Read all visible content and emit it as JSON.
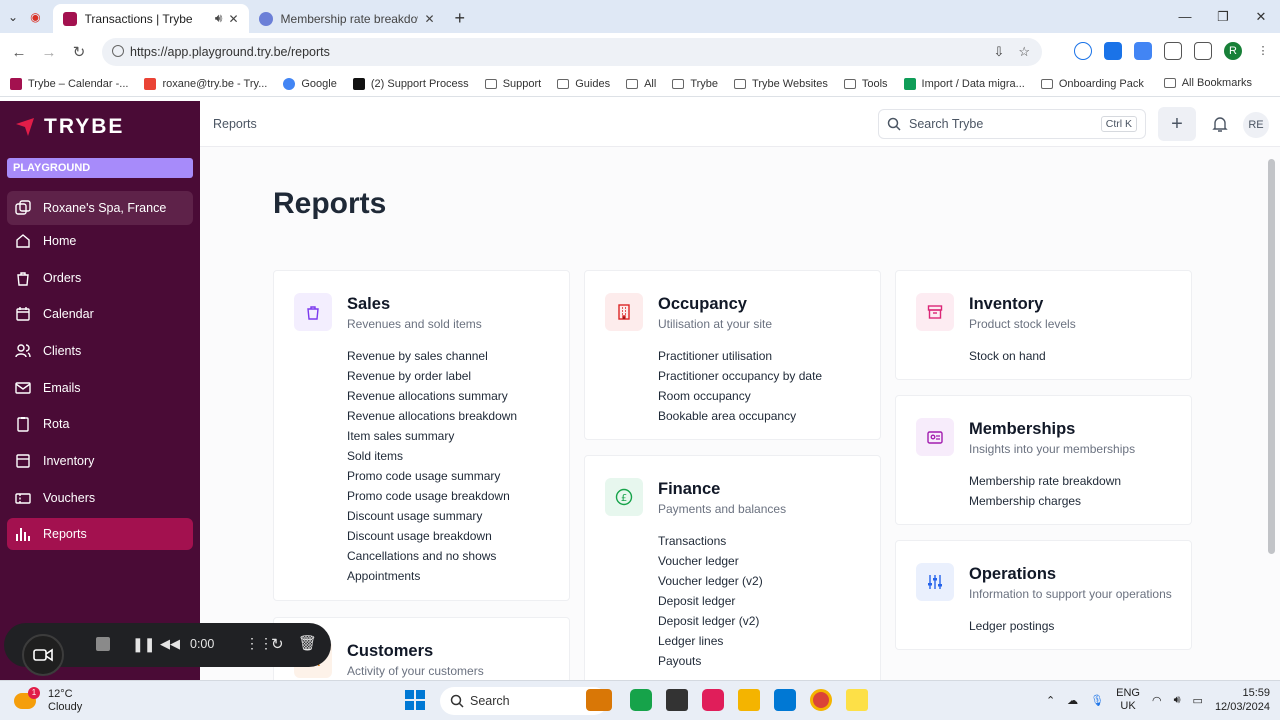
{
  "browser": {
    "tabs": [
      {
        "title": "Transactions | Trybe",
        "active": true
      },
      {
        "title": "Membership rate breakdown | ",
        "active": false
      }
    ],
    "url": "https://app.playground.try.be/reports",
    "bookmarks": [
      "Trybe – Calendar -...",
      "roxane@try.be - Try...",
      "Google",
      "(2) Support Process",
      "Support",
      "Guides",
      "All",
      "Trybe",
      "Trybe Websites",
      "Tools",
      "Import / Data migra...",
      "Onboarding Pack"
    ],
    "all_bookmarks": "All Bookmarks"
  },
  "sidebar": {
    "brand": "TRYBE",
    "environment": "PLAYGROUND",
    "site": "Roxane's Spa, France",
    "items": [
      {
        "label": "Home",
        "icon": "home-icon"
      },
      {
        "label": "Orders",
        "icon": "bag-icon"
      },
      {
        "label": "Calendar",
        "icon": "calendar-icon"
      },
      {
        "label": "Clients",
        "icon": "users-icon"
      },
      {
        "label": "Emails",
        "icon": "mail-icon"
      },
      {
        "label": "Rota",
        "icon": "clipboard-icon"
      },
      {
        "label": "Inventory",
        "icon": "inventory-icon"
      },
      {
        "label": "Vouchers",
        "icon": "voucher-icon"
      },
      {
        "label": "Reports",
        "icon": "chart-icon",
        "active": true
      }
    ]
  },
  "header": {
    "breadcrumb": "Reports",
    "search_placeholder": "Search Trybe",
    "shortcut": "Ctrl K",
    "avatar": "RE"
  },
  "page": {
    "title": "Reports",
    "cards": {
      "sales": {
        "title": "Sales",
        "subtitle": "Revenues and sold items",
        "links": [
          "Revenue by sales channel",
          "Revenue by order label",
          "Revenue allocations summary",
          "Revenue allocations breakdown",
          "Item sales summary",
          "Sold items",
          "Promo code usage summary",
          "Promo code usage breakdown",
          "Discount usage summary",
          "Discount usage breakdown",
          "Cancellations and no shows",
          "Appointments"
        ]
      },
      "occupancy": {
        "title": "Occupancy",
        "subtitle": "Utilisation at your site",
        "links": [
          "Practitioner utilisation",
          "Practitioner occupancy by date",
          "Room occupancy",
          "Bookable area occupancy"
        ]
      },
      "inventory": {
        "title": "Inventory",
        "subtitle": "Product stock levels",
        "links": [
          "Stock on hand"
        ]
      },
      "memberships": {
        "title": "Memberships",
        "subtitle": "Insights into your memberships",
        "links": [
          "Membership rate breakdown",
          "Membership charges"
        ]
      },
      "finance": {
        "title": "Finance",
        "subtitle": "Payments and balances",
        "links": [
          "Transactions",
          "Voucher ledger",
          "Voucher ledger (v2)",
          "Deposit ledger",
          "Deposit ledger (v2)",
          "Ledger lines",
          "Payouts"
        ]
      },
      "operations": {
        "title": "Operations",
        "subtitle": "Information to support your operations",
        "links": [
          "Ledger postings"
        ]
      },
      "customers": {
        "title": "Customers",
        "subtitle": "Activity of your customers"
      }
    }
  },
  "recorder": {
    "time": "0:00"
  },
  "taskbar": {
    "temp": "12°C",
    "weather": "Cloudy",
    "search": "Search",
    "lang1": "ENG",
    "lang2": "UK",
    "time": "15:59",
    "date": "12/03/2024"
  },
  "colors": {
    "sidebar": "#4a0b36",
    "accent": "#a3114f",
    "env_badge": "#a78bfa"
  }
}
